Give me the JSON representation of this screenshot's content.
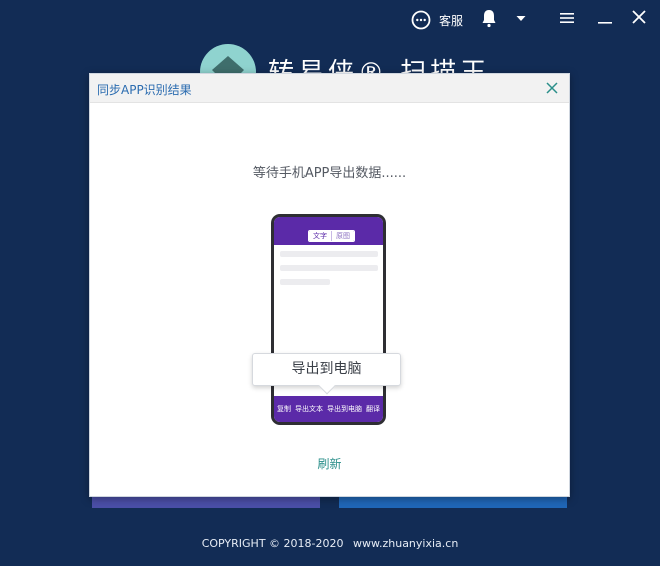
{
  "topbar": {
    "service_label": "客服",
    "service_icon": "chat-bubble-icon",
    "bell_icon": "bell-icon",
    "caret_icon": "caret-down-icon",
    "menu_icon": "hamburger-menu-icon",
    "minimize_icon": "minimize-icon",
    "close_icon": "close-icon"
  },
  "app": {
    "title": "转易侠® 扫描王",
    "logo_icon": "mascot-logo-icon"
  },
  "dialog": {
    "title": "同步APP识别结果",
    "close_icon": "close-icon",
    "wait_text": "等待手机APP导出数据......",
    "phone": {
      "tabs": [
        "文字",
        "原图"
      ],
      "footer_actions": [
        "复制",
        "导出文本",
        "导出到电脑",
        "翻译"
      ]
    },
    "export_tooltip": "导出到电脑",
    "refresh_label": "刷新"
  },
  "footer": {
    "copyright": "COPYRIGHT © 2018-2020",
    "website": "www.zhuanyixia.cn"
  },
  "colors": {
    "background": "#122c55",
    "phone_accent": "#5b2aa8",
    "link": "#2a8f8a",
    "dialog_title": "#2b6cb0"
  }
}
